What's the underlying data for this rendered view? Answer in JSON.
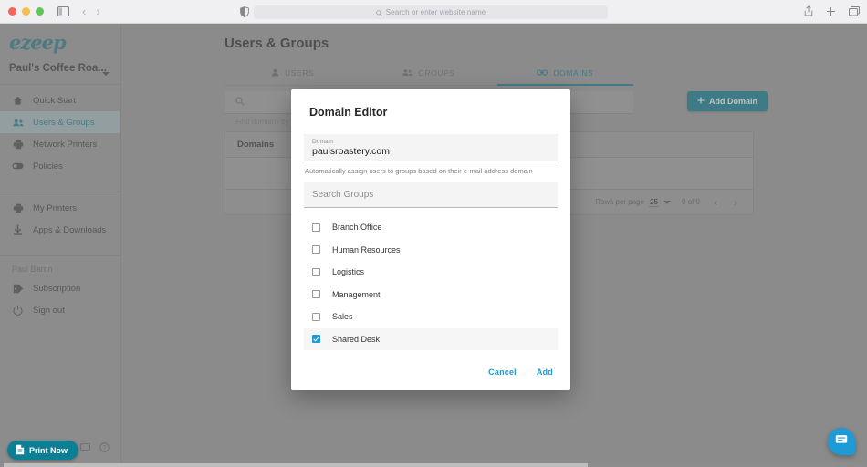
{
  "browser": {
    "address_placeholder": "Search or enter website name",
    "icons": {
      "sidebar_toggle": "sidebar-toggle-icon",
      "back": "back-chevron-icon",
      "forward": "forward-chevron-icon",
      "shield": "privacy-shield-icon",
      "search": "search-icon",
      "share": "share-icon",
      "new_tab": "plus-icon",
      "tab_overview": "tabs-icon"
    }
  },
  "sidebar": {
    "logo": "ezeep",
    "org_name": "Paul's Coffee Roa...",
    "groups": [
      {
        "items": [
          {
            "label": "Quick Start",
            "icon": "home-icon",
            "active": false
          },
          {
            "label": "Users & Groups",
            "icon": "users-icon",
            "active": true
          },
          {
            "label": "Network Printers",
            "icon": "printer-network-icon",
            "active": false
          },
          {
            "label": "Policies",
            "icon": "toggle-icon",
            "active": false
          }
        ]
      },
      {
        "items": [
          {
            "label": "My Printers",
            "icon": "printer-icon",
            "active": false
          },
          {
            "label": "Apps & Downloads",
            "icon": "download-icon",
            "active": false
          }
        ]
      }
    ],
    "user_label": "Paul Baron",
    "user_items": [
      {
        "label": "Subscription",
        "icon": "tag-icon"
      },
      {
        "label": "Sign out",
        "icon": "power-icon"
      }
    ]
  },
  "main": {
    "page_title": "Users & Groups",
    "tabs": [
      {
        "label": "USERS",
        "icon": "user-icon",
        "active": false
      },
      {
        "label": "GROUPS",
        "icon": "users-icon",
        "active": false
      },
      {
        "label": "DOMAINS",
        "icon": "link-icon",
        "active": true
      }
    ],
    "search_placeholder": "",
    "search_hint": "Find domains by their name",
    "add_domain_label": "Add Domain",
    "table": {
      "column_header": "Domains",
      "rows": []
    },
    "pagination": {
      "rows_per_page_label": "Rows per page",
      "rows_per_page_value": "25",
      "range_label": "0 of 0",
      "prev_icon": "chevron-left-icon",
      "next_icon": "chevron-right-icon"
    }
  },
  "modal": {
    "title": "Domain Editor",
    "domain_field": {
      "label": "Domain",
      "value": "paulsroastery.com"
    },
    "helper_text": "Automatically assign users to groups based on their e-mail address domain",
    "search_groups_placeholder": "Search Groups",
    "groups": [
      {
        "label": "Branch Office",
        "checked": false
      },
      {
        "label": "Human Resources",
        "checked": false
      },
      {
        "label": "Logistics",
        "checked": false
      },
      {
        "label": "Management",
        "checked": false
      },
      {
        "label": "Sales",
        "checked": false
      },
      {
        "label": "Shared Desk",
        "checked": true
      }
    ],
    "cancel_label": "Cancel",
    "add_label": "Add"
  },
  "footer": {
    "print_now_label": "Print Now",
    "chat_icon": "chat-icon",
    "help_icon": "help-icon",
    "feedback_icon": "feedback-icon",
    "chat_widget_icon": "chat-bubble-icon"
  },
  "colors": {
    "accent_teal": "#0d7f95",
    "accent_blue": "#1e9ad6",
    "tab_active": "#157f93",
    "logo": "#2e7d8e"
  }
}
